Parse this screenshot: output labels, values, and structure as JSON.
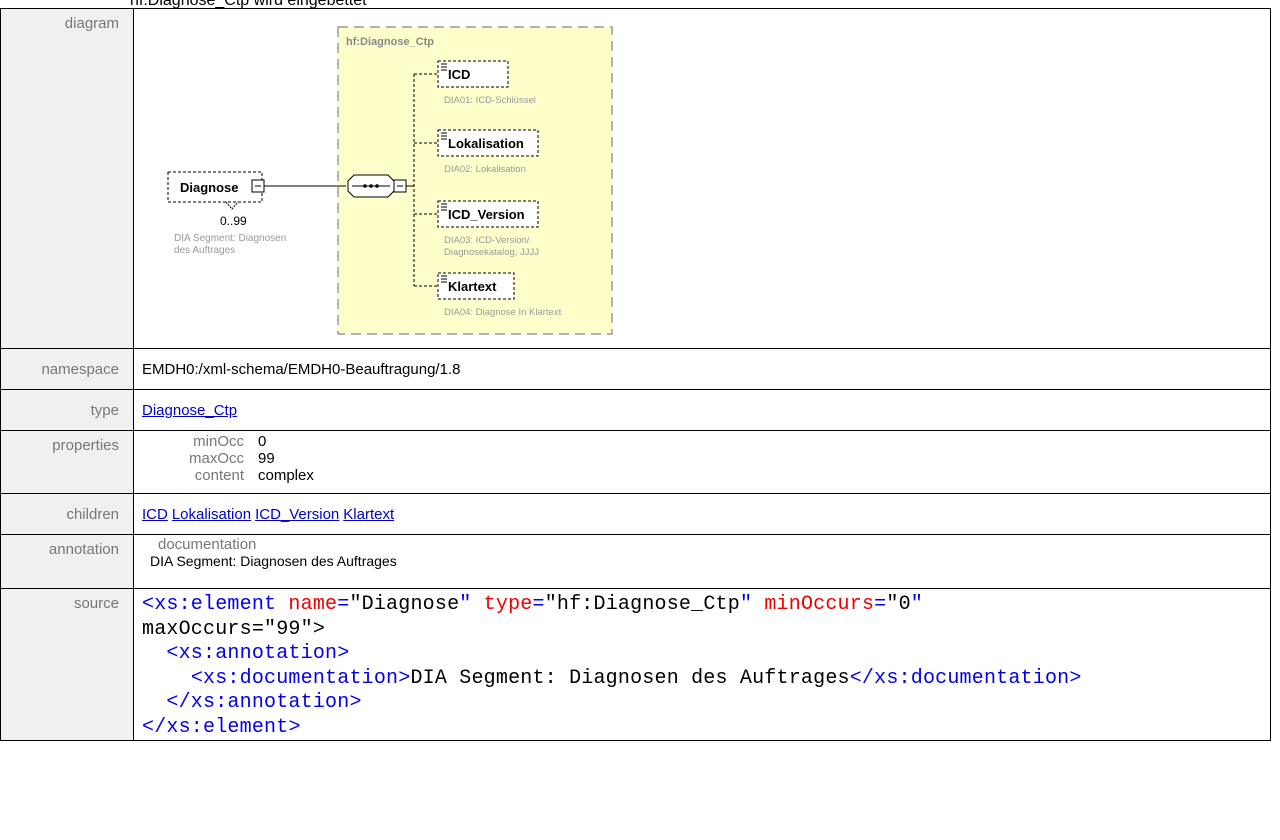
{
  "header_text": "hf:Diagnose_Ctp wird eingebettet",
  "rows": {
    "diagram": {
      "label": "diagram",
      "type_box_title": "hf:Diagnose_Ctp",
      "root_element": "Diagnose",
      "root_occurs": "0..99",
      "root_doc_line1": "DIA Segment: Diagnosen",
      "root_doc_line2": "des Auftrages",
      "children": [
        {
          "name": "ICD",
          "doc1": "DIA01: ICD-Schlüssel",
          "doc2": ""
        },
        {
          "name": "Lokalisation",
          "doc1": "DIA02: Lokalisation",
          "doc2": ""
        },
        {
          "name": "ICD_Version",
          "doc1": "DIA03: ICD-Version/",
          "doc2": "Diagnosekatalog, JJJJ"
        },
        {
          "name": "Klartext",
          "doc1": "DIA04: Diagnose In Klartext",
          "doc2": ""
        }
      ]
    },
    "namespace": {
      "label": "namespace",
      "value": "EMDH0:/xml-schema/EMDH0-Beauftragung/1.8"
    },
    "type": {
      "label": "type",
      "value": "Diagnose_Ctp"
    },
    "properties": {
      "label": "properties",
      "items": [
        {
          "key": "minOcc",
          "value": "0"
        },
        {
          "key": "maxOcc",
          "value": "99"
        },
        {
          "key": "content",
          "value": "complex"
        }
      ]
    },
    "children": {
      "label": "children",
      "links": [
        "ICD",
        "Lokalisation",
        "ICD_Version",
        "Klartext"
      ]
    },
    "annotation": {
      "label": "annotation",
      "heading": "documentation",
      "text": "DIA Segment: Diagnosen des Auftrages"
    },
    "source": {
      "label": "source",
      "lines": [
        "<xs:element name=\"Diagnose\" type=\"hf:Diagnose_Ctp\" minOccurs=\"0\"",
        "maxOccurs=\"99\">",
        "  <xs:annotation>",
        "    <xs:documentation>DIA Segment: Diagnosen des Auftrages</xs:documentation>",
        "  </xs:annotation>",
        "</xs:element>"
      ]
    }
  },
  "colors": {
    "tag": "#0000ee",
    "attr": "#ee0000",
    "link": "#0000cc",
    "label_bg": "#f0f0f0",
    "complex_type_bg": "#ffffcc"
  }
}
